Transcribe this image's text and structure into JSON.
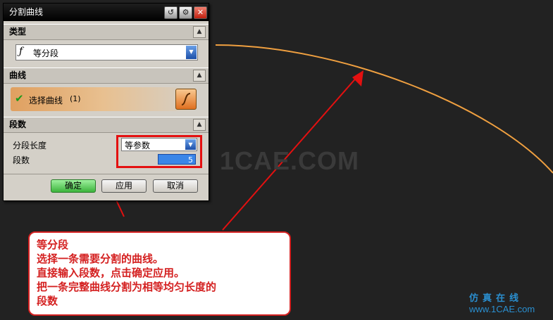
{
  "watermark": "1CAE.COM",
  "dialog": {
    "title": "分割曲线",
    "title_buttons": [
      "reset-icon",
      "gear-icon",
      "close-icon"
    ],
    "sections": {
      "type": {
        "title": "类型",
        "selected": "等分段",
        "icon": "curve-segment-icon"
      },
      "curve": {
        "title": "曲线",
        "select_label": "选择曲线",
        "select_count": "(1)",
        "check_icon": "checkmark-icon",
        "curve_button_icon": "curve-icon"
      },
      "segments": {
        "title": "段数",
        "length_label": "分段长度",
        "length_mode": "等参数",
        "count_label": "段数",
        "count_value": "5"
      }
    },
    "buttons": {
      "ok": "确定",
      "apply": "应用",
      "cancel": "取消"
    }
  },
  "annotation": {
    "lines": [
      "等分段",
      "选择一条需要分割的曲线。",
      "直接输入段数，点击确定应用。",
      "把一条完整曲线分割为相等均匀长度的",
      "段数"
    ]
  },
  "logo": {
    "text_cn": "仿真在线",
    "text_en": "www.1CAE.com"
  },
  "colors": {
    "background": "#222222",
    "curve": "#f0a040",
    "annotation_red": "#d42020",
    "selection_fill": "#e0b080"
  }
}
